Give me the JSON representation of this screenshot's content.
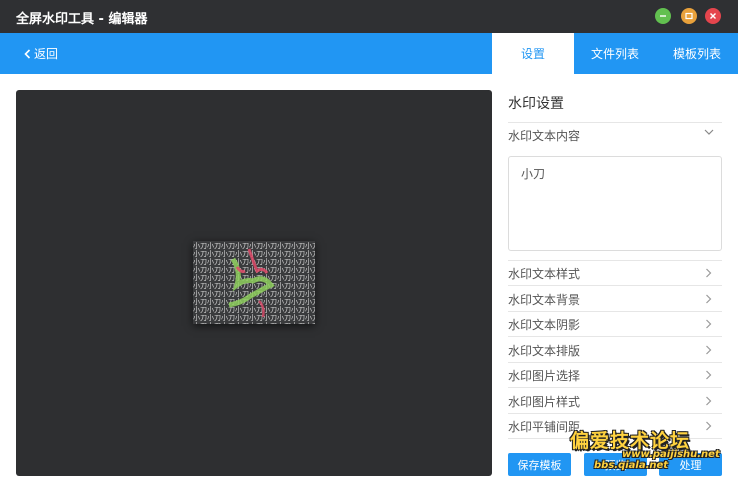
{
  "window": {
    "title": "全屏水印工具 - 编辑器"
  },
  "nav": {
    "back_label": "返回",
    "tabs": [
      {
        "label": "设置",
        "active": true
      },
      {
        "label": "文件列表",
        "active": false
      },
      {
        "label": "模板列表",
        "active": false
      }
    ]
  },
  "preview": {
    "watermark_glyph": "小刀"
  },
  "panel": {
    "title": "水印设置",
    "text_content": {
      "label": "水印文本内容",
      "value": "小刀",
      "expanded": true
    },
    "sections": [
      {
        "label": "水印文本样式"
      },
      {
        "label": "水印文本背景"
      },
      {
        "label": "水印文本阴影"
      },
      {
        "label": "水印文本排版"
      },
      {
        "label": "水印图片选择"
      },
      {
        "label": "水印图片样式"
      },
      {
        "label": "水印平铺间距"
      }
    ],
    "buttons": {
      "save": "保存模板",
      "preview": "预览",
      "process": "处理"
    }
  },
  "overlay_watermark": {
    "line1": "偏爱技术论坛",
    "line2": "www.paijishu.net",
    "line3": "bbs.qiala.net"
  },
  "colors": {
    "titlebar": "#2f3033",
    "accent": "#2196f3",
    "canvas": "#2e2f31",
    "minimize": "#62c050",
    "maximize": "#e9a13b",
    "close": "#e5454d"
  }
}
